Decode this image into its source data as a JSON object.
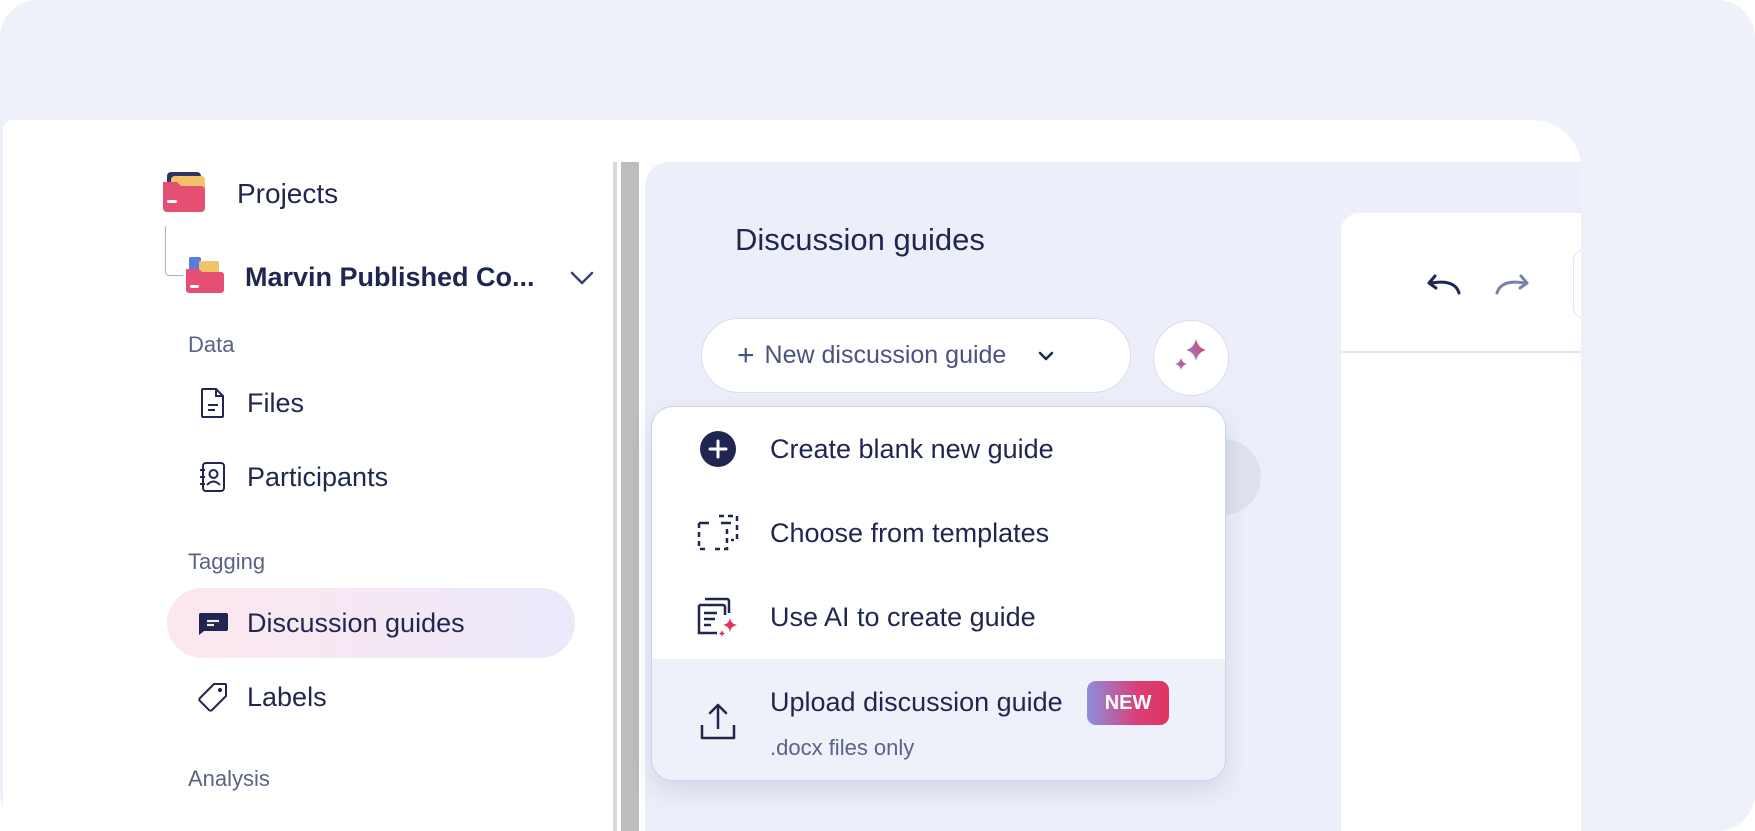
{
  "sidebar": {
    "projects_label": "Projects",
    "project_name": "Marvin Published Co...",
    "sections": {
      "data": "Data",
      "tagging": "Tagging",
      "analysis": "Analysis"
    },
    "items": {
      "files": "Files",
      "participants": "Participants",
      "discussion_guides": "Discussion guides",
      "labels": "Labels"
    }
  },
  "main": {
    "title": "Discussion guides",
    "new_guide_label": "New discussion guide"
  },
  "dropdown": {
    "create_blank": "Create blank new guide",
    "choose_templates": "Choose from templates",
    "use_ai": "Use AI to create guide",
    "upload_title": "Upload discussion guide",
    "upload_sub": ".docx files only",
    "badge": "NEW"
  },
  "colors": {
    "text_primary": "#1f2650",
    "accent_pink": "#e0345f",
    "accent_purple": "#8b8fe0",
    "active_bg": "#fde7ee"
  }
}
